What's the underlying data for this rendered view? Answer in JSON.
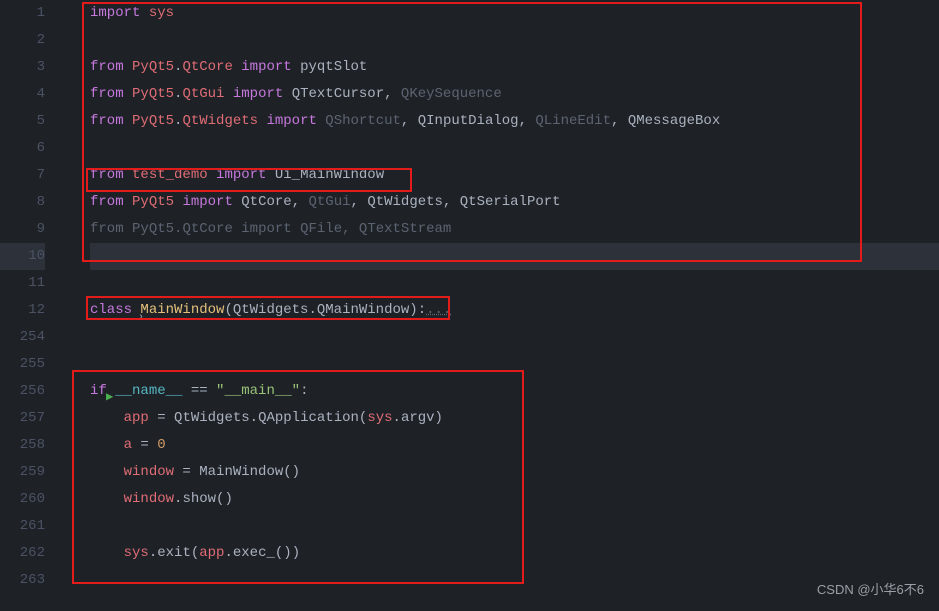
{
  "gutter": {
    "l1": "1",
    "l2": "2",
    "l3": "3",
    "l4": "4",
    "l5": "5",
    "l6": "6",
    "l7": "7",
    "l8": "8",
    "l9": "9",
    "l10": "10",
    "l11": "11",
    "l12": "12",
    "l254": "254",
    "l255": "255",
    "l256": "256",
    "l257": "257",
    "l258": "258",
    "l259": "259",
    "l260": "260",
    "l261": "261",
    "l262": "262",
    "l263": "263"
  },
  "tok": {
    "import": "import",
    "from": "from",
    "class": "class",
    "if": "if",
    "sys": "sys",
    "PyQt5": "PyQt5",
    "QtCore": "QtCore",
    "QtGui": "QtGui",
    "QtWidgets": "QtWidgets",
    "QtSerialPort": "QtSerialPort",
    "pyqtSlot": "pyqtSlot",
    "QTextCursor": "QTextCursor",
    "QKeySequence": "QKeySequence",
    "QShortcut": "QShortcut",
    "QInputDialog": "QInputDialog",
    "QLineEdit": "QLineEdit",
    "QMessageBox": "QMessageBox",
    "test_demo": "test_demo",
    "Ui_MainWindow": "Ui_MainWindow",
    "QFile": "QFile",
    "QTextStream": "QTextStream",
    "MainWindow": "MainWindow",
    "QMainWindow": "QMainWindow",
    "fold": "...",
    "name_dunder": "__name__",
    "main_str": "\"__main__\"",
    "app": "app",
    "a": "a",
    "window": "window",
    "zero": "0",
    "argv": "argv",
    "QApplication": "QApplication",
    "show": "show",
    "exit": "exit",
    "exec": "exec_",
    "dot": ".",
    "comma": ", ",
    "colon": ":",
    "eq": " = ",
    "eqeq": " == ",
    "lpar": "(",
    "rpar": ")",
    "sp": " "
  },
  "watermark": "CSDN @小华6不6"
}
